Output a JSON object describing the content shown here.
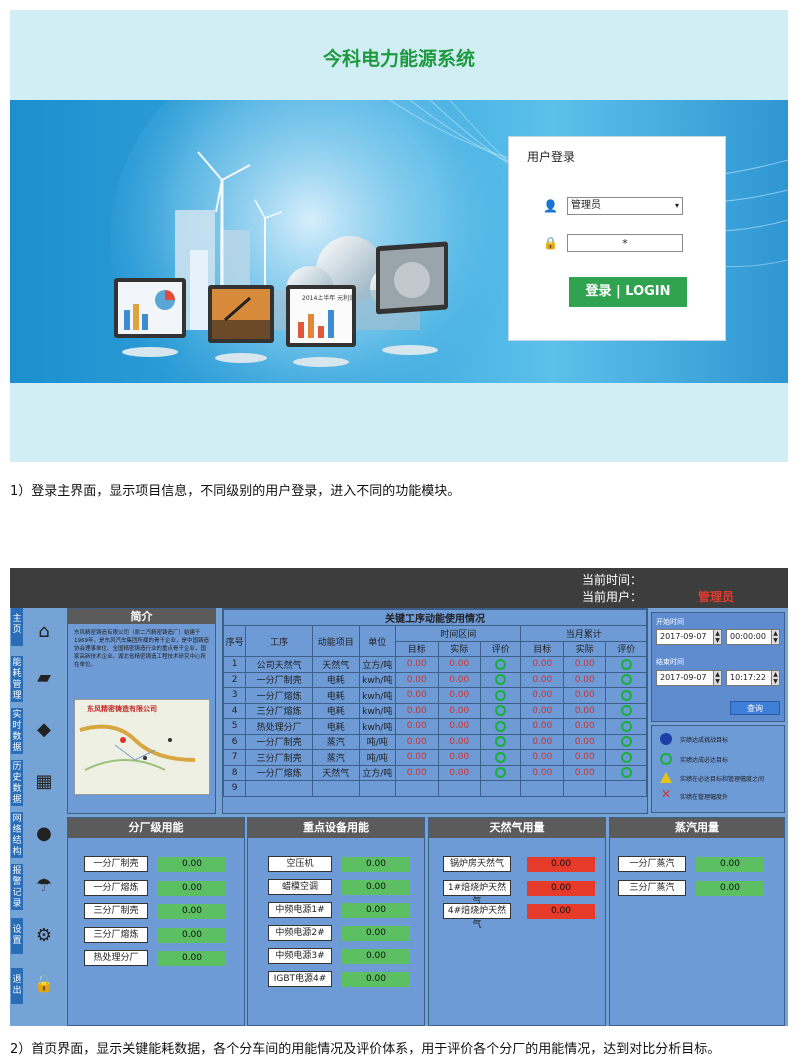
{
  "login_screen": {
    "title": "今科电力能源系统",
    "login_box": {
      "heading": "用户登录",
      "user_select": "管理员",
      "password": "*",
      "button": "登录 | LOGIN"
    },
    "monitor_text": "2014上半年 元利润"
  },
  "caption1": "1）登录主界面，显示项目信息，不同级别的用户登录，进入不同的功能模块。",
  "main_screen": {
    "header": {
      "time_label": "当前时间：",
      "user_label": "当前用户：",
      "user_value": "管理员"
    },
    "nav": [
      {
        "label": "主页",
        "icon": "home-icon",
        "glyph": "⌂"
      },
      {
        "label": "能耗管理",
        "icon": "book-icon",
        "glyph": "▰"
      },
      {
        "label": "实时数据",
        "icon": "cubes-icon",
        "glyph": "◆"
      },
      {
        "label": "历史数据",
        "icon": "calendar-icon",
        "glyph": "▦"
      },
      {
        "label": "网络结构",
        "icon": "chat-icon",
        "glyph": "●"
      },
      {
        "label": "报警记录",
        "icon": "umbrella-icon",
        "glyph": "☂"
      },
      {
        "label": "设置",
        "icon": "gear-icon",
        "glyph": "⚙"
      },
      {
        "label": "退出",
        "icon": "lock-icon",
        "glyph": "🔓"
      }
    ],
    "intro": {
      "title": "简介",
      "text": "东风精密铸造有限公司（原二汽精密铸造厂）始建于1969年，是东风汽车集团所属的骨干企业，是中国铸造协会理事单位、全国精密铸造行业的重点骨干企业，国家高新技术企业。湖北省精密铸造工程技术研究中心所在单位。",
      "map_title": "东风精密铸造有限公司"
    },
    "key_process": {
      "title": "关键工序动能使用情况",
      "group_time": "时间区间",
      "group_month": "当月累计",
      "columns": [
        "序号",
        "工序",
        "动能项目",
        "单位",
        "目标",
        "实际",
        "评价",
        "目标",
        "实际",
        "评价"
      ],
      "rows": [
        {
          "no": "1",
          "process": "公司天然气",
          "item": "天然气",
          "unit": "立方/吨",
          "t1": "0.00",
          "a1": "0.00",
          "t2": "0.00",
          "a2": "0.00"
        },
        {
          "no": "2",
          "process": "一分厂制壳",
          "item": "电耗",
          "unit": "kwh/吨",
          "t1": "0.00",
          "a1": "0.00",
          "t2": "0.00",
          "a2": "0.00"
        },
        {
          "no": "3",
          "process": "一分厂熔炼",
          "item": "电耗",
          "unit": "kwh/吨",
          "t1": "0.00",
          "a1": "0.00",
          "t2": "0.00",
          "a2": "0.00"
        },
        {
          "no": "4",
          "process": "三分厂熔炼",
          "item": "电耗",
          "unit": "kwh/吨",
          "t1": "0.00",
          "a1": "0.00",
          "t2": "0.00",
          "a2": "0.00"
        },
        {
          "no": "5",
          "process": "热处理分厂",
          "item": "电耗",
          "unit": "kwh/吨",
          "t1": "0.00",
          "a1": "0.00",
          "t2": "0.00",
          "a2": "0.00"
        },
        {
          "no": "6",
          "process": "一分厂制壳",
          "item": "蒸汽",
          "unit": "吨/吨",
          "t1": "0.00",
          "a1": "0.00",
          "t2": "0.00",
          "a2": "0.00"
        },
        {
          "no": "7",
          "process": "三分厂制壳",
          "item": "蒸汽",
          "unit": "吨/吨",
          "t1": "0.00",
          "a1": "0.00",
          "t2": "0.00",
          "a2": "0.00"
        },
        {
          "no": "8",
          "process": "一分厂熔炼",
          "item": "天然气",
          "unit": "立方/吨",
          "t1": "0.00",
          "a1": "0.00",
          "t2": "0.00",
          "a2": "0.00"
        },
        {
          "no": "9",
          "process": "",
          "item": "",
          "unit": "",
          "t1": "",
          "a1": "",
          "t2": "",
          "a2": ""
        }
      ]
    },
    "query": {
      "start_label": "开始时间",
      "start_date": "2017-09-07",
      "start_time": "00:00:00",
      "end_label": "结束时间",
      "end_date": "2017-09-07",
      "end_time": "10:17:22",
      "button": "查询"
    },
    "legend": [
      {
        "text": "实绩达成挑战目标",
        "color": "#1f3fa8"
      },
      {
        "text": "实绩达成必达目标",
        "color": "#18b03a"
      },
      {
        "text": "实绩在必达目标和管理幅度之间",
        "color": "#e6c417"
      },
      {
        "text": "实绩在管理幅度外",
        "color": "#e0302a"
      }
    ],
    "branch_energy": {
      "title": "分厂级用能",
      "items": [
        {
          "label": "一分厂制壳",
          "value": "0.00"
        },
        {
          "label": "一分厂熔炼",
          "value": "0.00"
        },
        {
          "label": "三分厂制壳",
          "value": "0.00"
        },
        {
          "label": "三分厂熔炼",
          "value": "0.00"
        },
        {
          "label": "热处理分厂",
          "value": "0.00"
        }
      ]
    },
    "key_equipment": {
      "title": "重点设备用能",
      "items": [
        {
          "label": "空压机",
          "value": "0.00"
        },
        {
          "label": "蜡模空调",
          "value": "0.00"
        },
        {
          "label": "中频电源1#",
          "value": "0.00"
        },
        {
          "label": "中频电源2#",
          "value": "0.00"
        },
        {
          "label": "中频电源3#",
          "value": "0.00"
        },
        {
          "label": "IGBT电源4#",
          "value": "0.00"
        }
      ]
    },
    "gas": {
      "title": "天然气用量",
      "items": [
        {
          "label": "锅炉房天然气",
          "value": "0.00"
        },
        {
          "label": "1#焙烧炉天然气",
          "value": "0.00"
        },
        {
          "label": "4#焙烧炉天然气",
          "value": "0.00"
        }
      ]
    },
    "steam": {
      "title": "蒸汽用量",
      "items": [
        {
          "label": "一分厂蒸汽",
          "value": "0.00"
        },
        {
          "label": "三分厂蒸汽",
          "value": "0.00"
        }
      ]
    }
  },
  "caption2": "2）首页界面，显示关键能耗数据，各个分车间的用能情况及评价体系，用于评价各个分厂的用能情况，达到对比分析目标。"
}
